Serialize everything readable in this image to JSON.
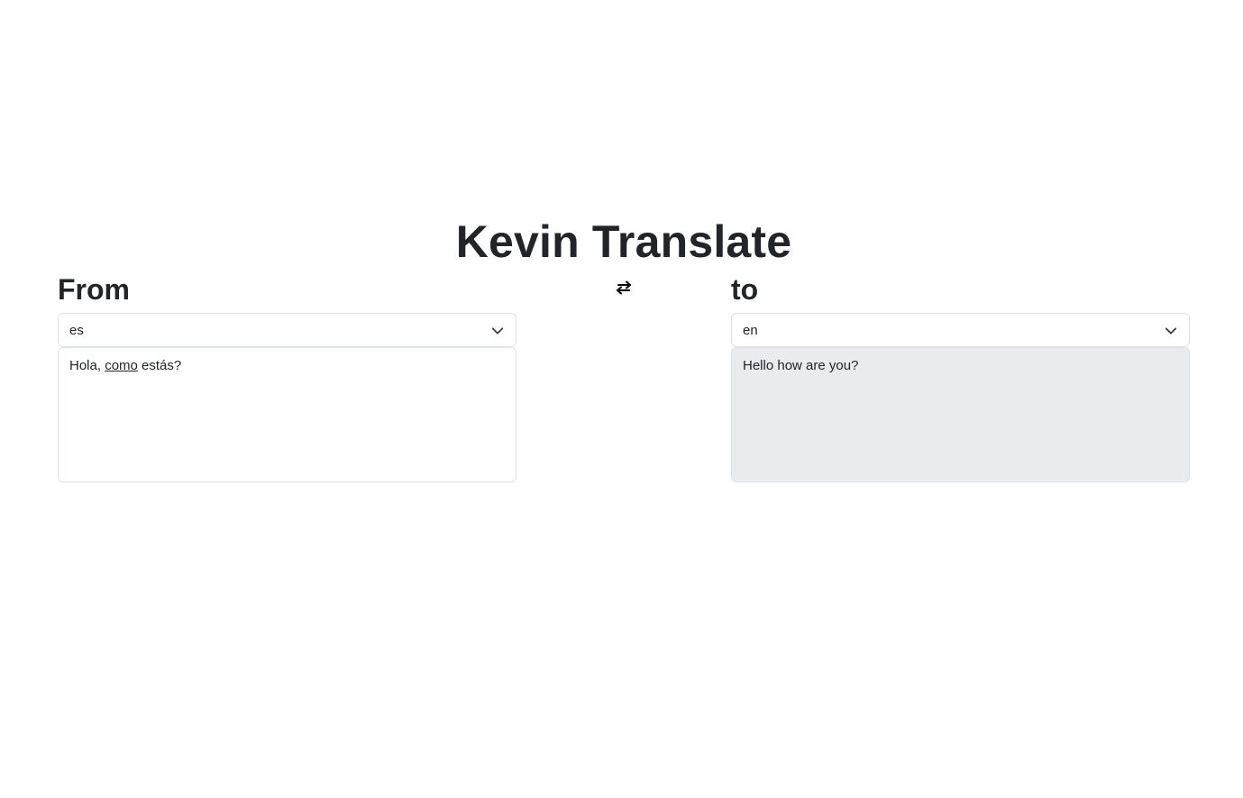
{
  "app": {
    "title": "Kevin Translate"
  },
  "from": {
    "heading": "From",
    "language": "es",
    "text_before": "Hola, ",
    "text_underlined": "como",
    "text_after": " estás?"
  },
  "to": {
    "heading": "to",
    "language": "en",
    "text": "Hello how are you?"
  },
  "icons": {
    "swap": "swap-arrows-icon",
    "chevron": "chevron-down-icon"
  },
  "colors": {
    "text": "#212529",
    "border": "#dee2e6",
    "result_background": "#e9ecef"
  }
}
